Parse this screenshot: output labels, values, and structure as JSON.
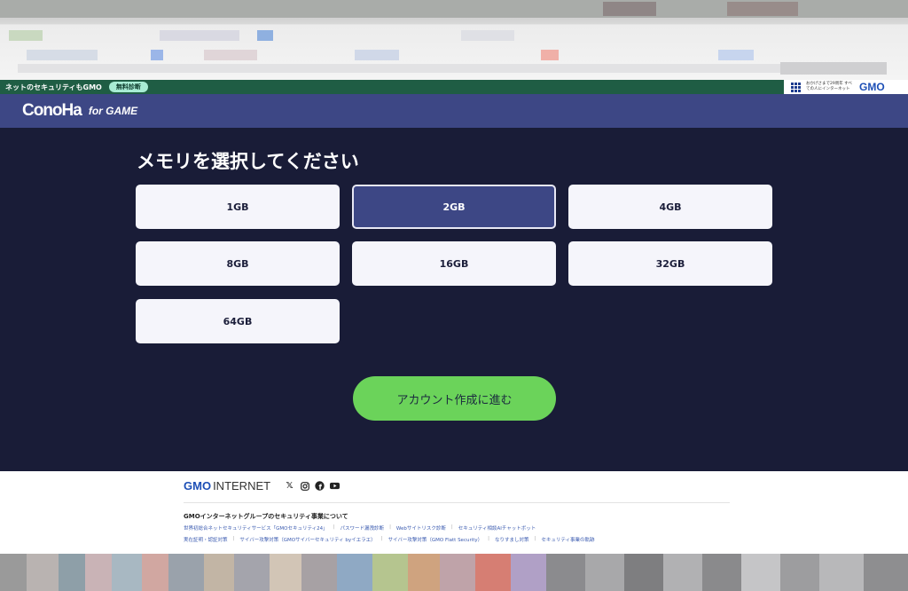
{
  "promo": {
    "text": "ネットのセキュリティもGMO",
    "badge": "無料診断",
    "right_sub": "おかげさまで29周年 すべての人にインターネット",
    "right_logo": "GMO"
  },
  "header": {
    "logo": "ConoHa",
    "logo_sub": "for GAME"
  },
  "main": {
    "title": "メモリを選択してください",
    "options": [
      {
        "label": "1GB",
        "selected": false
      },
      {
        "label": "2GB",
        "selected": true
      },
      {
        "label": "4GB",
        "selected": false
      },
      {
        "label": "8GB",
        "selected": false
      },
      {
        "label": "16GB",
        "selected": false
      },
      {
        "label": "32GB",
        "selected": false
      },
      {
        "label": "64GB",
        "selected": false
      }
    ],
    "cta": "アカウント作成に進む"
  },
  "footer": {
    "brand_gmo": "GMO",
    "brand_internet": "INTERNET",
    "heading": "GMOインターネットグループのセキュリティ事業について",
    "links_row1": [
      "世界初総合ネットセキュリティサービス「GMOセキュリティ24」",
      "パスワード漏洩診断",
      "Webサイトリスク診断",
      "セキュリティ相談AIチャットボット"
    ],
    "links_row2": [
      "実在証明・認証対策",
      "サイバー攻撃対策（GMOサイバーセキュリティ byイエラエ）",
      "サイバー攻撃対策（GMO Flatt Security）",
      "なりすまし対策",
      "セキュリティ事業の軌跡"
    ]
  },
  "colors": {
    "background": "#191c37",
    "header": "#3d4785",
    "selected": "#3d4785",
    "cta": "#6bd35a"
  }
}
